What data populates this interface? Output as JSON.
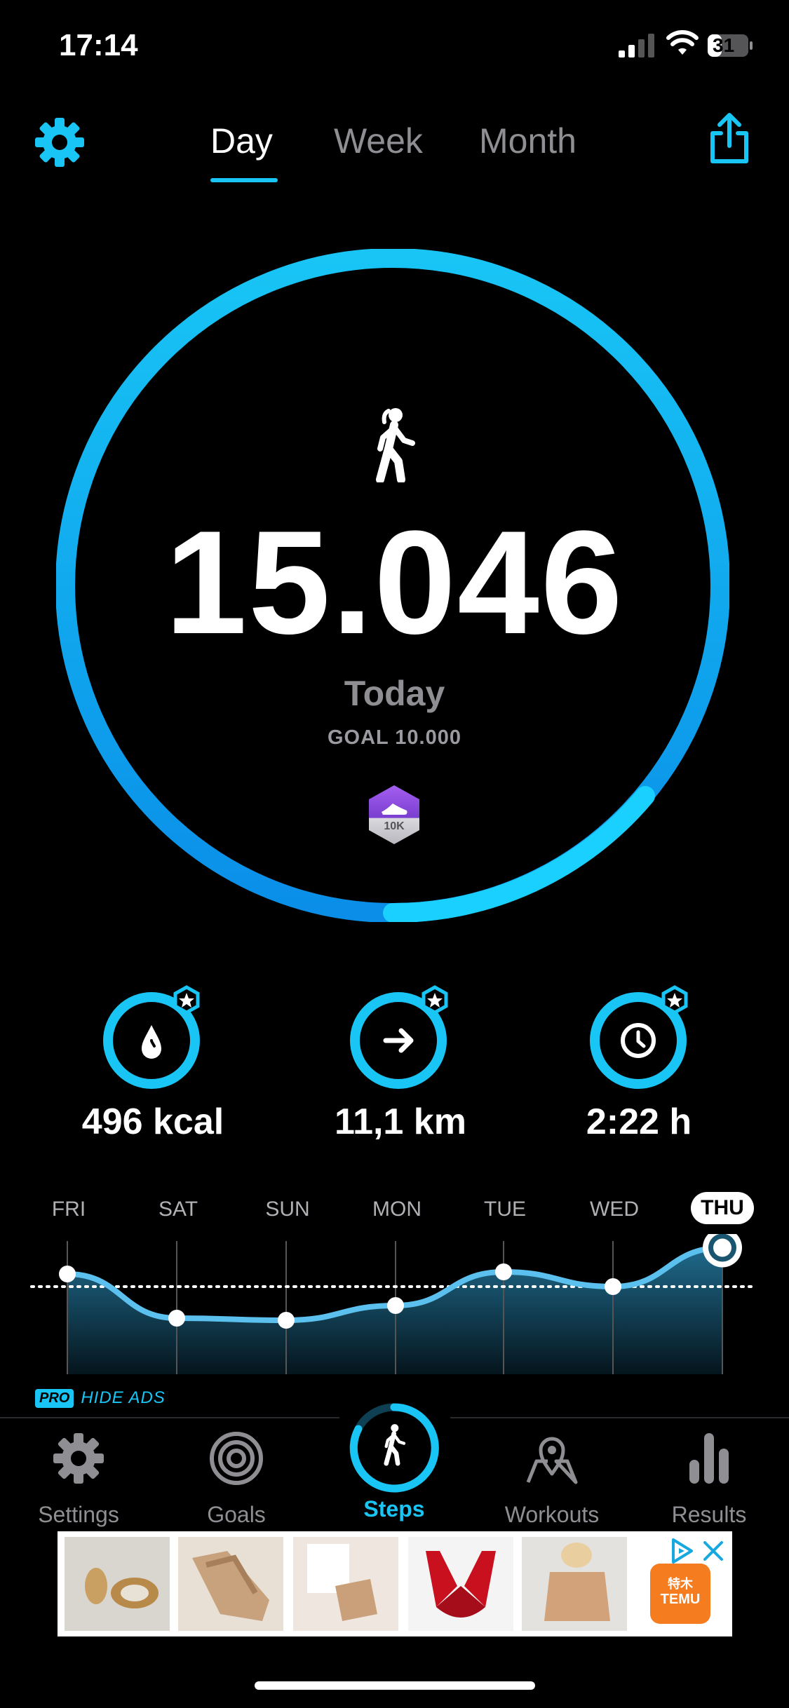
{
  "status_bar": {
    "time": "17:14",
    "battery": "31"
  },
  "header": {
    "tabs": [
      {
        "label": "Day",
        "active": true
      },
      {
        "label": "Week",
        "active": false
      },
      {
        "label": "Month",
        "active": false
      }
    ],
    "left_icon": "gear-icon",
    "right_icon": "share-icon"
  },
  "colors": {
    "accent": "#18c5f5",
    "ring_deep": "#0a8ee8",
    "background": "#000000",
    "muted": "#8e8e93",
    "badge_purple": "#8a4fd8"
  },
  "main": {
    "steps": "15.046",
    "period_label": "Today",
    "goal_label": "GOAL 10.000",
    "goal_progress": 1.0,
    "badge": "10K"
  },
  "stats": [
    {
      "icon": "flame-icon",
      "value": "496 kcal"
    },
    {
      "icon": "arrow-right-icon",
      "value": "11,1 km"
    },
    {
      "icon": "clock-icon",
      "value": "2:22 h"
    }
  ],
  "week": {
    "days": [
      "FRI",
      "SAT",
      "SUN",
      "MON",
      "TUE",
      "WED",
      "THU"
    ],
    "selected": "THU",
    "relative_values": [
      0.92,
      0.5,
      0.48,
      0.62,
      0.94,
      0.8,
      1.17
    ],
    "goal_level": 0.8
  },
  "promo": {
    "tag": "PRO",
    "text": "HIDE ADS"
  },
  "tabbar": {
    "items": [
      {
        "label": "Settings",
        "icon": "gear-icon",
        "active": false
      },
      {
        "label": "Goals",
        "icon": "target-icon",
        "active": false
      },
      {
        "label": "Steps",
        "icon": "walker-icon",
        "active": true
      },
      {
        "label": "Workouts",
        "icon": "map-pin-icon",
        "active": false
      },
      {
        "label": "Results",
        "icon": "bar-chart-icon",
        "active": false
      }
    ]
  },
  "ad": {
    "brand": "TEMU",
    "brand_cn": "特木"
  }
}
